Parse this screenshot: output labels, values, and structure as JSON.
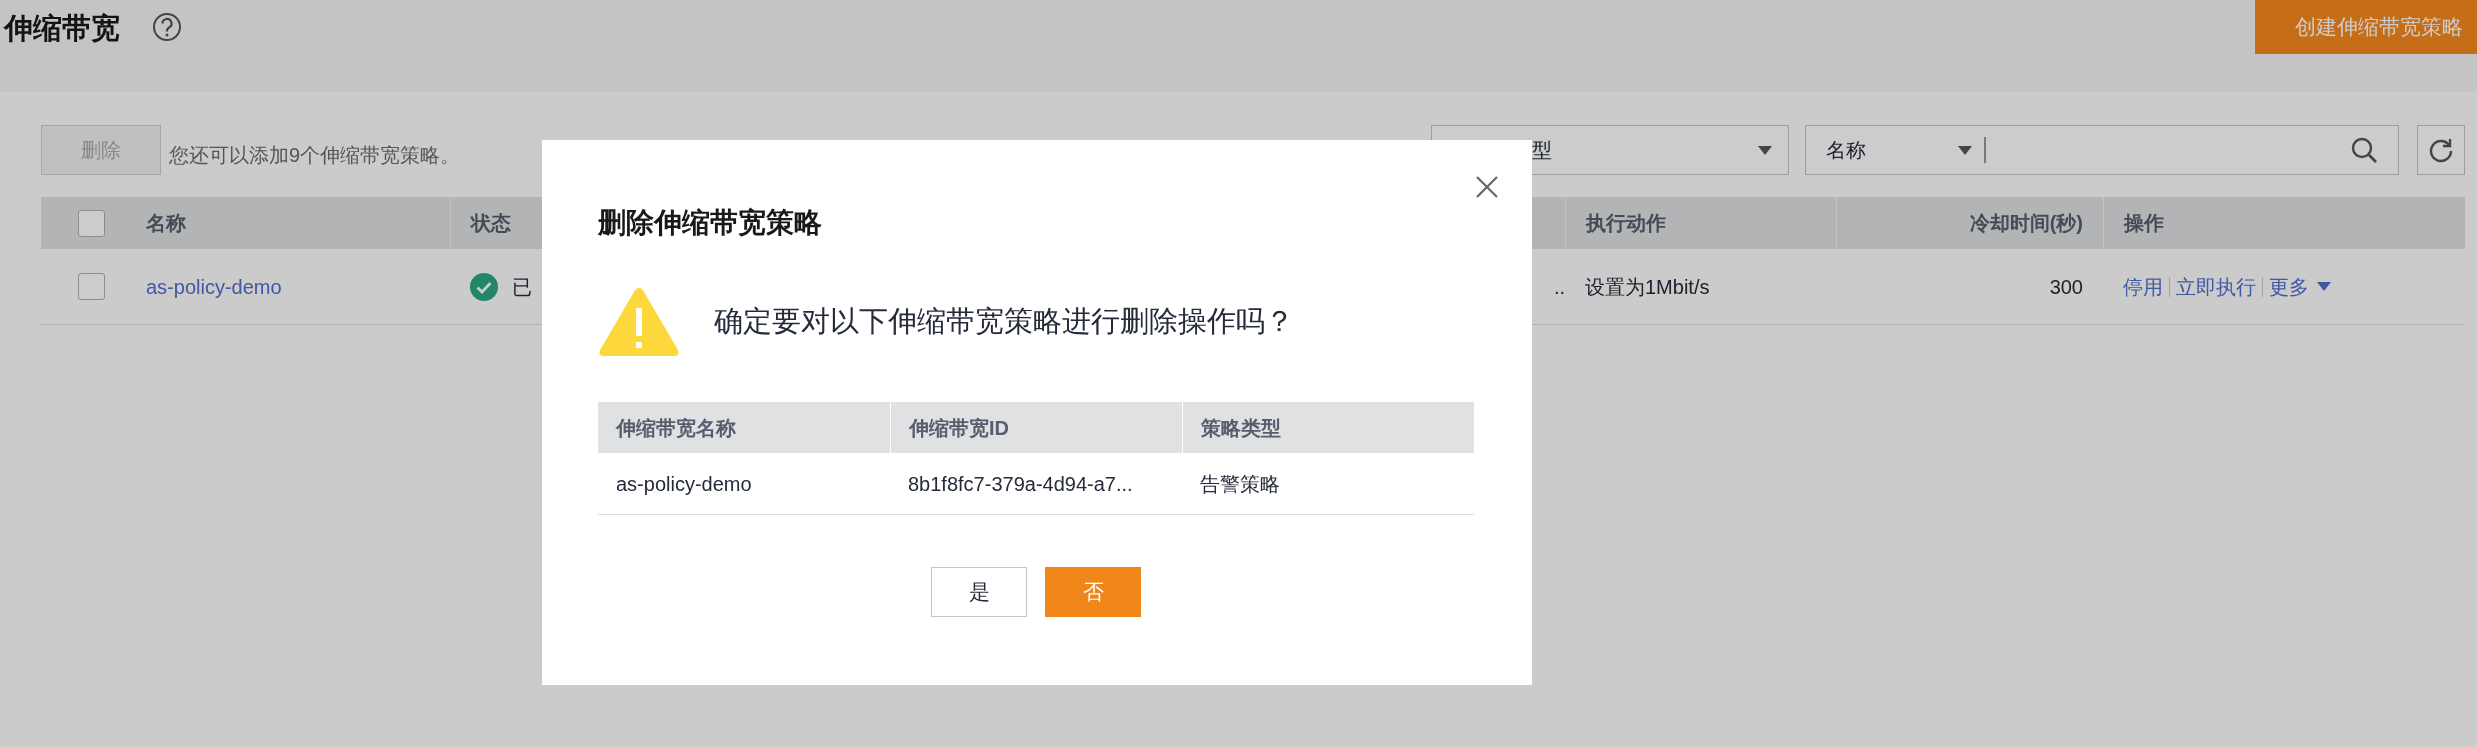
{
  "page": {
    "title": "伸缩带宽",
    "create_button": "创建伸缩带宽策略"
  },
  "toolbar": {
    "delete_button": {
      "label": "删除",
      "disabled": true
    },
    "hint": "您还可以添加9个伸缩带宽策略。",
    "filter": {
      "value": "型"
    },
    "search": {
      "attribute": "名称"
    }
  },
  "table": {
    "header_checkbox": {
      "checked": false
    },
    "columns": [
      "名称",
      "状态",
      "",
      "执行动作",
      "冷却时间(秒)",
      "操作"
    ],
    "rows": [
      {
        "checked": false,
        "name": "as-policy-demo",
        "status": "已",
        "column_3": "..",
        "action": "设置为1Mbit/s",
        "cooldown": "300",
        "operations": [
          {
            "label": "停用",
            "kind": "link"
          },
          {
            "label": "立即执行",
            "kind": "link"
          },
          {
            "label": "更多",
            "kind": "dropdown"
          }
        ]
      }
    ]
  },
  "dialog": {
    "title": "删除伸缩带宽策略",
    "message": "确定要对以下伸缩带宽策略进行删除操作吗？",
    "table": {
      "columns": [
        "伸缩带宽名称",
        "伸缩带宽ID",
        "策略类型"
      ],
      "rows": [
        [
          "as-policy-demo",
          "8b1f8fc7-379a-4d94-a7...",
          "告警策略"
        ]
      ]
    },
    "buttons": [
      {
        "label": "是",
        "primary": false
      },
      {
        "label": "否",
        "primary": true
      }
    ]
  }
}
